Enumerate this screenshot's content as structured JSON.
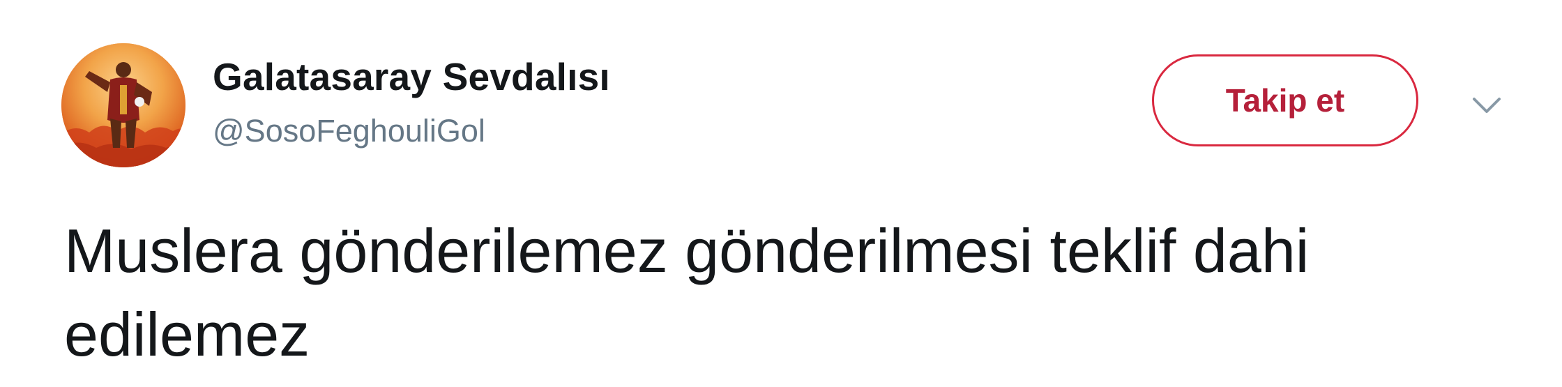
{
  "tweet": {
    "author": {
      "display_name": "Galatasaray Sevdalısı",
      "handle": "@SosoFeghouliGol",
      "avatar_icon": "profile-avatar"
    },
    "actions": {
      "follow_label": "Takip et",
      "menu_icon": "chevron-down-icon"
    },
    "text": "Muslera gönderilemez gönderilmesi teklif dahi edilemez"
  },
  "colors": {
    "follow_accent": "#d9283f",
    "text_primary": "#14171a",
    "text_secondary": "#657786"
  }
}
